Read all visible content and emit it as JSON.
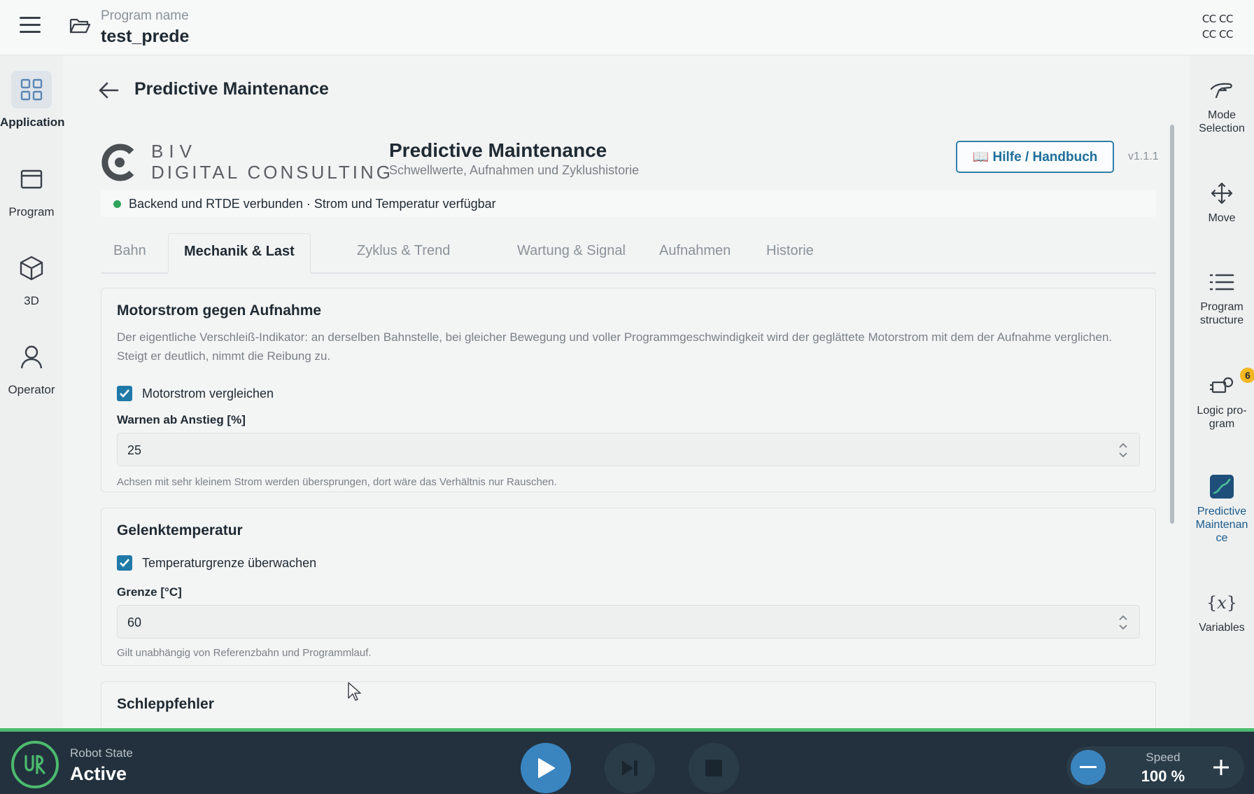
{
  "header": {
    "program_label": "Program name",
    "program_name": "test_prede",
    "cc_line1": "CC CC",
    "cc_line2": "CC CC"
  },
  "left_nav": [
    {
      "label": "Application",
      "icon": "grid-icon",
      "active": true
    },
    {
      "label": "Program",
      "icon": "program-window-icon",
      "active": false
    },
    {
      "label": "3D",
      "icon": "cube-icon",
      "active": false
    },
    {
      "label": "Operator",
      "icon": "person-icon",
      "active": false
    }
  ],
  "right_nav": [
    {
      "label": "Mode Selection",
      "icon": "mode-hand-icon"
    },
    {
      "label": "Move",
      "icon": "move-arrows-icon"
    },
    {
      "label": "Program structure",
      "icon": "list-icon"
    },
    {
      "label": "Logic pro-gram",
      "icon": "logic-program-icon",
      "badge": "6"
    },
    {
      "label": "Predictive Maintenan ce",
      "icon": "predictive-chart-icon"
    },
    {
      "label": "Variables",
      "icon": "variables-icon"
    }
  ],
  "page": {
    "title": "Predictive Maintenance"
  },
  "app": {
    "logo_line1": "BIV",
    "logo_line2": "DIGITAL CONSULTING",
    "title": "Predictive Maintenance",
    "subtitle": "Schwellwerte, Aufnahmen und Zyklushistorie",
    "help_button": "📖 Hilfe / Handbuch",
    "version": "v1.1.1",
    "status_text": "Backend und RTDE verbunden · Strom und Temperatur verfügbar",
    "status_color": "#2fa35a"
  },
  "tabs": [
    {
      "label": "Bahn",
      "active": false
    },
    {
      "label": "Mechanik & Last",
      "active": true
    },
    {
      "label": "Zyklus & Trend",
      "active": false
    },
    {
      "label": "Wartung & Signal",
      "active": false
    },
    {
      "label": "Aufnahmen",
      "active": false
    },
    {
      "label": "Historie",
      "active": false
    }
  ],
  "cards": {
    "motor": {
      "title": "Motorstrom gegen Aufnahme",
      "description": "Der eigentliche Verschleiß-Indikator: an derselben Bahnstelle, bei gleicher Bewegung und voller Programmgeschwindigkeit wird der geglättete Motorstrom mit dem der Aufnahme verglichen. Steigt er deutlich, nimmt die Reibung zu.",
      "checkbox_label": "Motorstrom vergleichen",
      "checked": true,
      "field_label": "Warnen ab Anstieg [%]",
      "field_value": "25",
      "hint": "Achsen mit sehr kleinem Strom werden übersprungen, dort wäre das Verhältnis nur Rauschen."
    },
    "temp": {
      "title": "Gelenktemperatur",
      "checkbox_label": "Temperaturgrenze überwachen",
      "checked": true,
      "field_label": "Grenze [°C]",
      "field_value": "60",
      "hint": "Gilt unabhängig von Referenzbahn und Programmlauf."
    },
    "drag": {
      "title": "Schleppfehler"
    }
  },
  "bottom": {
    "robot_state_label": "Robot State",
    "robot_state_value": "Active",
    "speed_label": "Speed",
    "speed_value": "100 %",
    "accent": "#3a85bf",
    "ok_color": "#4cbb6e"
  }
}
